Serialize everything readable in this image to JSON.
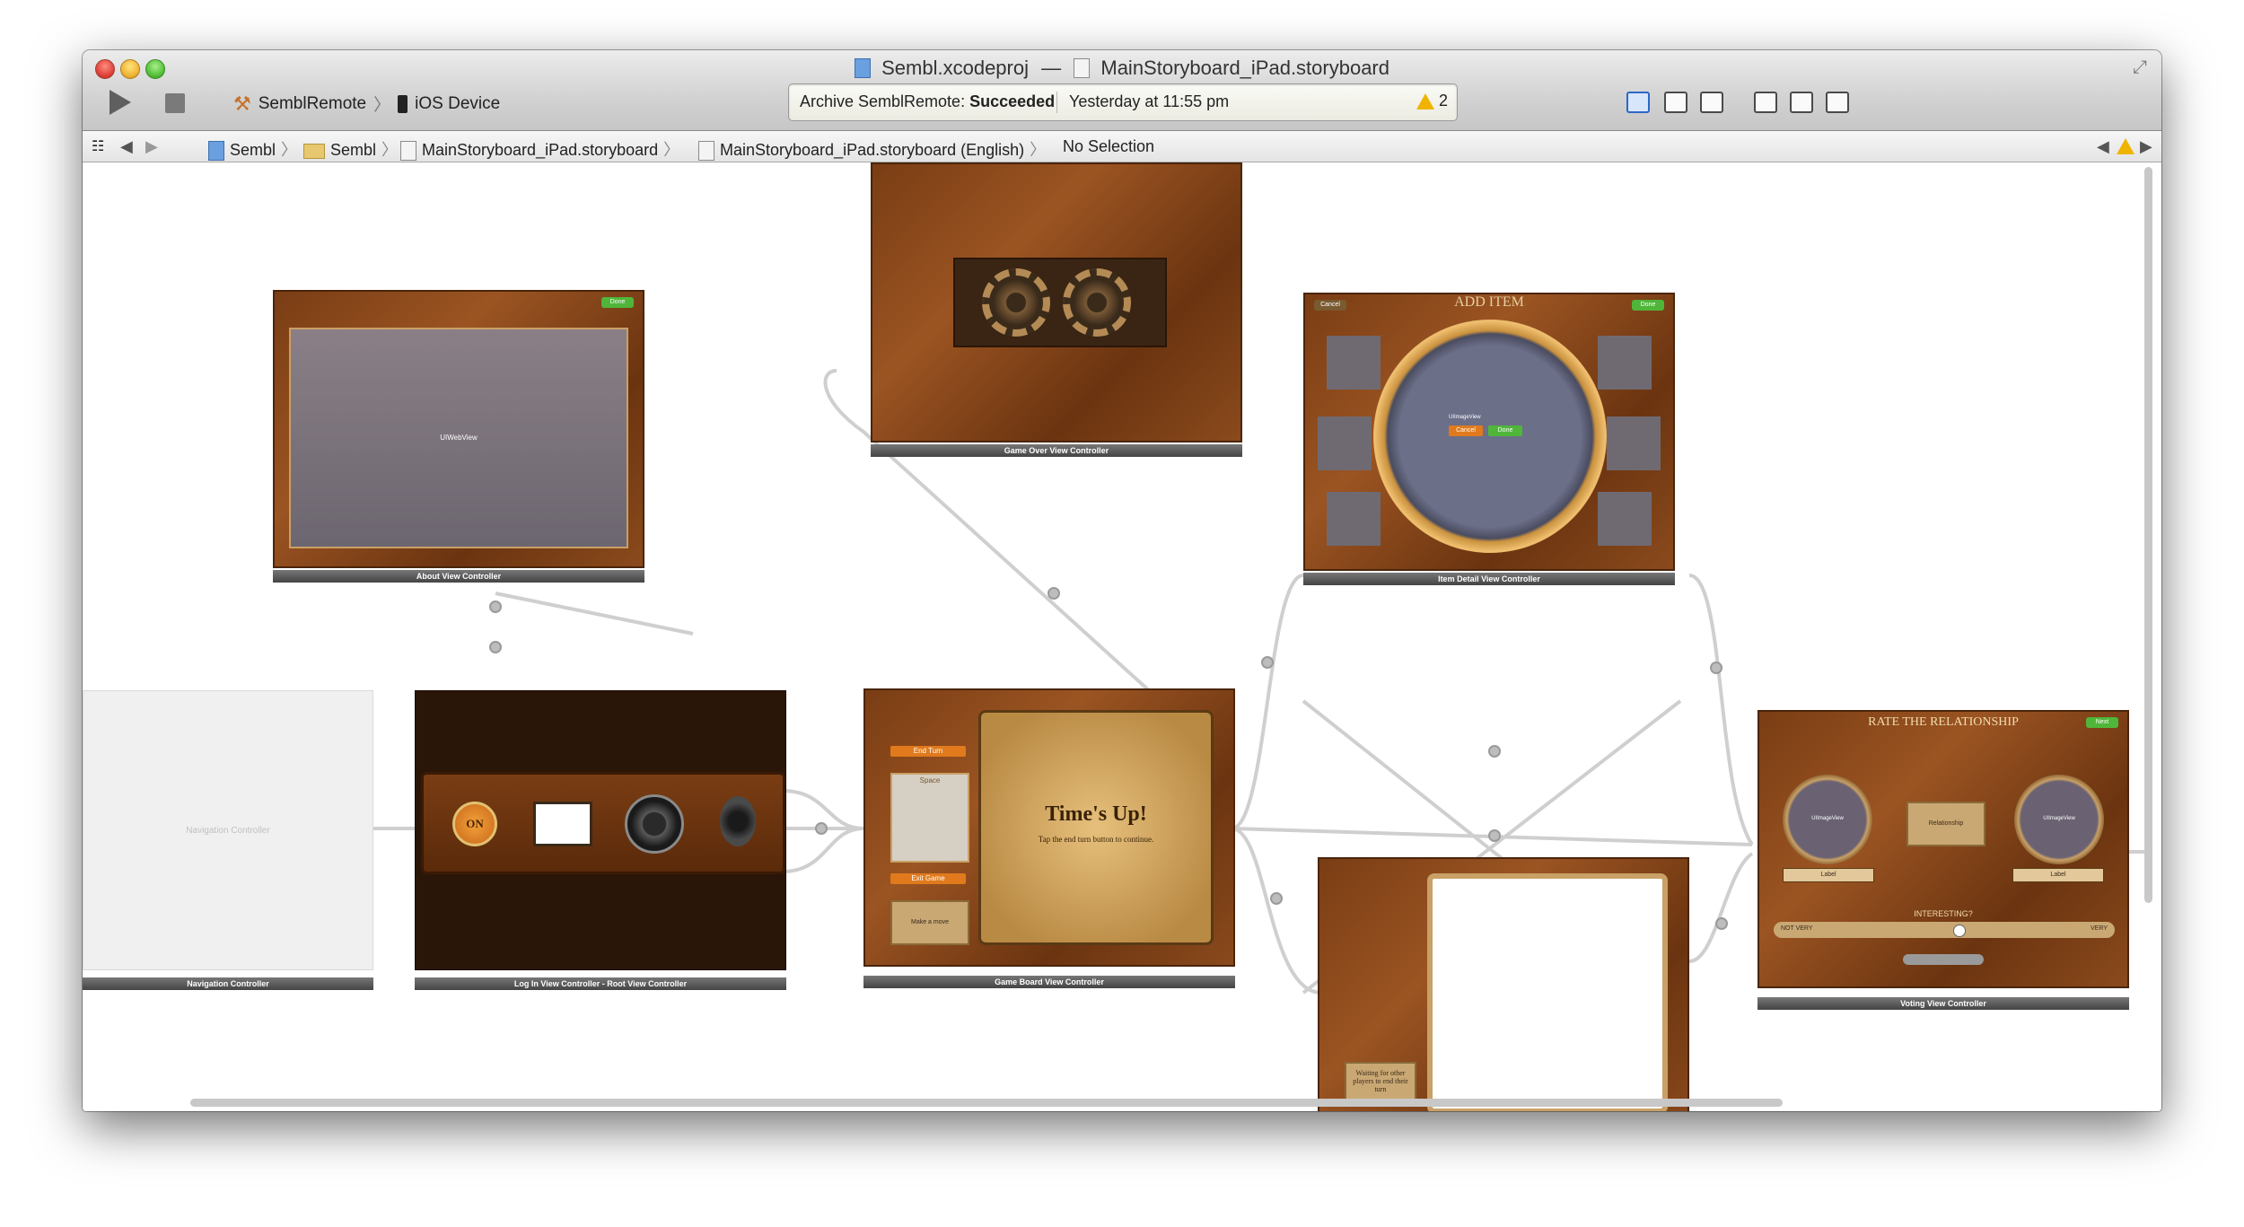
{
  "window": {
    "title_project": "Sembl.xcodeproj",
    "title_separator": "—",
    "title_file": "MainStoryboard_iPad.storyboard"
  },
  "toolbar": {
    "scheme_name": "SemblRemote",
    "scheme_chevron": "〉",
    "destination": "iOS Device",
    "activity_prefix": "Archive SemblRemote:",
    "activity_status": "Succeeded",
    "activity_time": "Yesterday at 11:55 pm",
    "warning_count": "2"
  },
  "jumpbar": {
    "items": [
      "Sembl",
      "Sembl",
      "MainStoryboard_iPad.storyboard",
      "MainStoryboard_iPad.storyboard (English)",
      "No Selection"
    ],
    "chevron": "〉"
  },
  "scenes": {
    "about": {
      "label": "About View Controller",
      "content": "UIWebView",
      "done": "Done"
    },
    "game_over": {
      "label": "Game Over View Controller"
    },
    "item_detail": {
      "label": "Item Detail View Controller",
      "title": "ADD ITEM",
      "done": "Done",
      "cancel": "Cancel",
      "inner_done": "Done",
      "inner_title": "UIImageView"
    },
    "navigation": {
      "label": "Navigation Controller",
      "placeholder": "Navigation Controller"
    },
    "login": {
      "label": "Log In View Controller - Root View Controller",
      "on_button": "ON"
    },
    "game_board": {
      "label": "Game Board View Controller",
      "heading": "Time's Up!",
      "subtext": "Tap the end turn button to continue.",
      "end_turn": "End Turn",
      "space": "Space",
      "exit_game": "Exit Game",
      "make_move": "Make a move"
    },
    "waiting": {
      "text": "Waiting for other players to end their turn"
    },
    "voting": {
      "label": "Voting View Controller",
      "title": "RATE THE RELATIONSHIP",
      "next": "Next",
      "image_left": "UIImageView",
      "image_right": "UIImageView",
      "relationship": "Relationship",
      "label_left": "Label",
      "label_right": "Label",
      "question": "INTERESTING?",
      "not_very": "NOT VERY",
      "very": "VERY"
    }
  },
  "colors": {
    "wood": "#8a4a1c",
    "brass": "#c9a066",
    "ui_accent": "#2b68c6",
    "warning": "#f0b400"
  }
}
